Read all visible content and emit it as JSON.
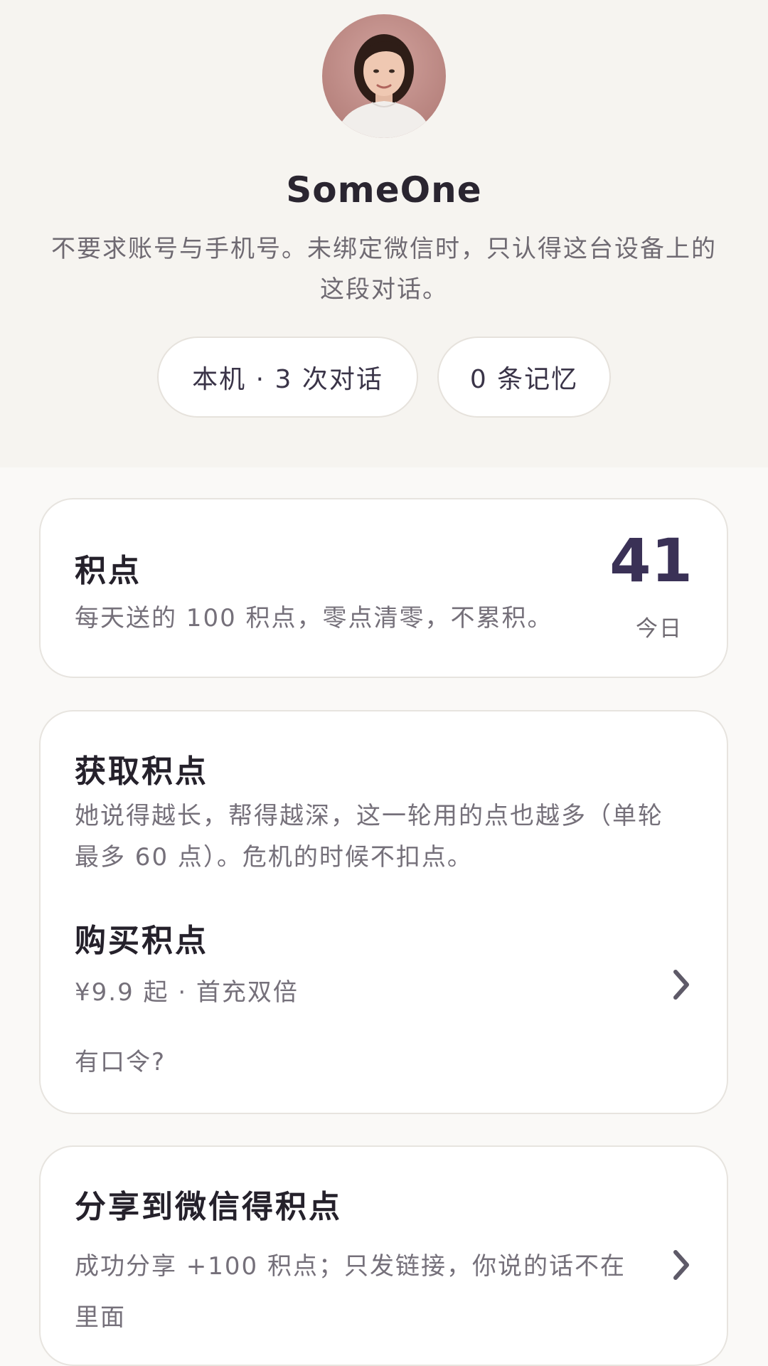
{
  "profile": {
    "name": "SomeOne",
    "subtitle": "不要求账号与手机号。未绑定微信时，只认得这台设备上的这段对话。",
    "stats": [
      {
        "label": "本机 · 3 次对话"
      },
      {
        "label": "0 条记忆"
      }
    ]
  },
  "points": {
    "title": "积点",
    "description": "每天送的 100 积点，零点清零，不累积。",
    "value": 41,
    "value_label": "今日"
  },
  "earn": {
    "title": "获取积点",
    "description": "她说得越长，帮得越深，这一轮用的点也越多（单轮最多 60 点）。危机的时候不扣点。",
    "buy_title": "购买积点",
    "buy_description": "¥9.9 起 · 首充双倍",
    "code_link": "有口令?"
  },
  "share": {
    "title": "分享到微信得积点",
    "description": "成功分享 +100 积点；只发链接，你说的话不在里面"
  },
  "colors": {
    "header_bg": "#f6f4f0",
    "page_bg": "#faf9f7",
    "accent": "#3a3156",
    "text_muted": "#75707a"
  },
  "icons": {
    "avatar": "user-avatar",
    "chevron": "chevron-right-icon"
  }
}
